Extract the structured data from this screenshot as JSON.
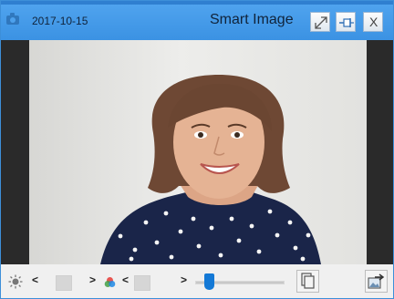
{
  "titlebar": {
    "date": "2017-10-15",
    "title": "Smart Image",
    "close_label": "X",
    "icons": [
      "camera-icon",
      "expand-icon",
      "pin-icon",
      "close-icon"
    ]
  },
  "viewer": {
    "image": "portrait of a smiling woman with shoulder-length brown hair in a navy polka-dot top"
  },
  "toolbar": {
    "prev_label": "<",
    "next_label": ">",
    "color_prev_label": "<",
    "color_next_label": ">",
    "slider_value": 0.12,
    "icons": [
      "brightness-icon",
      "color-wheel-icon",
      "copy-icon",
      "export-image-icon"
    ],
    "colors": {
      "accent": "#1479d6",
      "titlebar": "#3b92e3"
    }
  }
}
